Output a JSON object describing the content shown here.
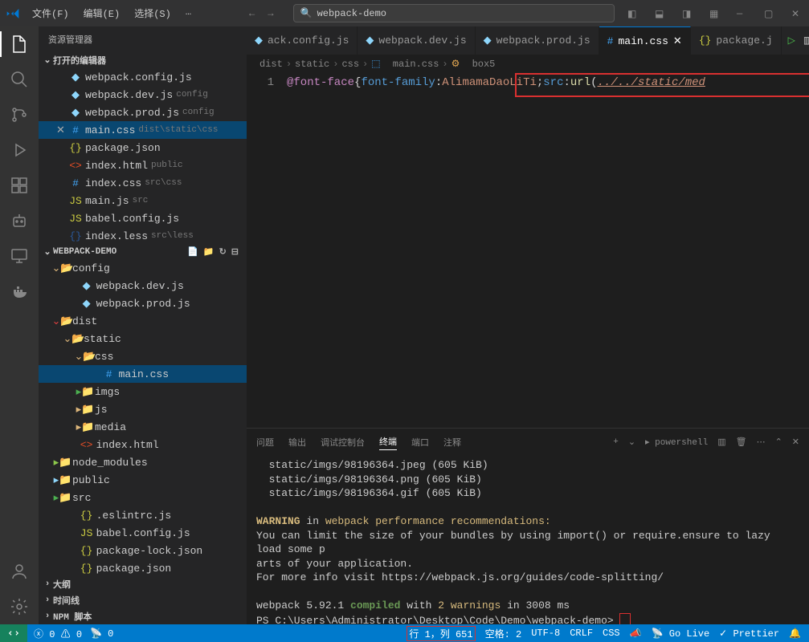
{
  "menu": {
    "file": "文件(F)",
    "edit": "编辑(E)",
    "select": "选择(S)",
    "more": "…"
  },
  "search_text": "webpack-demo",
  "sidebar_title": "资源管理器",
  "open_editors": {
    "title": "打开的编辑器",
    "items": [
      {
        "name": "webpack.config.js",
        "desc": ""
      },
      {
        "name": "webpack.dev.js",
        "desc": "config"
      },
      {
        "name": "webpack.prod.js",
        "desc": "config"
      },
      {
        "name": "main.css",
        "desc": "dist\\static\\css",
        "active": true
      },
      {
        "name": "package.json",
        "desc": ""
      },
      {
        "name": "index.html",
        "desc": "public"
      },
      {
        "name": "index.css",
        "desc": "src\\css"
      },
      {
        "name": "main.js",
        "desc": "src"
      },
      {
        "name": "babel.config.js",
        "desc": ""
      },
      {
        "name": "index.less",
        "desc": "src\\less"
      }
    ]
  },
  "project": {
    "name": "WEBPACK-DEMO",
    "tree": [
      {
        "l": 1,
        "t": "folder-open",
        "n": "config"
      },
      {
        "l": 2,
        "t": "webpack",
        "n": "webpack.dev.js"
      },
      {
        "l": 2,
        "t": "webpack",
        "n": "webpack.prod.js"
      },
      {
        "l": 1,
        "t": "folder-open",
        "n": "dist",
        "cls": "ico-red"
      },
      {
        "l": 2,
        "t": "folder-open",
        "n": "static"
      },
      {
        "l": 3,
        "t": "folder-open",
        "n": "css"
      },
      {
        "l": 4,
        "t": "css",
        "n": "main.css",
        "sel": true
      },
      {
        "l": 3,
        "t": "folder",
        "n": "imgs",
        "cls": "ico-src"
      },
      {
        "l": 3,
        "t": "folder",
        "n": "js"
      },
      {
        "l": 3,
        "t": "folder",
        "n": "media"
      },
      {
        "l": 2,
        "t": "html",
        "n": "index.html"
      },
      {
        "l": 1,
        "t": "folder",
        "n": "node_modules",
        "cls": "ico-node"
      },
      {
        "l": 1,
        "t": "folder",
        "n": "public",
        "cls": "ico-webpack"
      },
      {
        "l": 1,
        "t": "folder",
        "n": "src",
        "cls": "ico-src"
      },
      {
        "l": 2,
        "t": "json",
        "n": ".eslintrc.js"
      },
      {
        "l": 2,
        "t": "js",
        "n": "babel.config.js"
      },
      {
        "l": 2,
        "t": "json",
        "n": "package-lock.json"
      },
      {
        "l": 2,
        "t": "json",
        "n": "package.json"
      }
    ]
  },
  "outline": "大纲",
  "timeline": "时间线",
  "npm": "NPM 脚本",
  "tabs": [
    {
      "n": "ack.config.js",
      "ico": "webpack"
    },
    {
      "n": "webpack.dev.js",
      "ico": "webpack"
    },
    {
      "n": "webpack.prod.js",
      "ico": "webpack"
    },
    {
      "n": "main.css",
      "ico": "css",
      "active": true,
      "close": true
    },
    {
      "n": "package.j",
      "ico": "json"
    }
  ],
  "breadcrumb": [
    "dist",
    "static",
    "css",
    "main.css",
    "box5"
  ],
  "code": {
    "line_num": "1",
    "at": "@font-face",
    "brace": "{",
    "p1": "font-family",
    "v1": "AlimamaDaoLiTi",
    "p2": "src",
    "fn": "url",
    "paren": "(",
    "path": "../../static/med"
  },
  "term": {
    "tabs": {
      "problems": "问题",
      "output": "输出",
      "debug": "调试控制台",
      "terminal": "终端",
      "ports": "端口",
      "comments": "注释"
    },
    "shell": "powershell",
    "lines": [
      "static/imgs/98196364.jpeg (605 KiB)",
      "static/imgs/98196364.png (605 KiB)",
      "static/imgs/98196364.gif (605 KiB)"
    ],
    "warn_label": "WARNING",
    "warn_in": " in ",
    "warn_msg": "webpack performance recommendations:",
    "warn_body1": "You can limit the size of your bundles by using import() or require.ensure to lazy load some p",
    "warn_body2": "arts of your application.",
    "warn_body3": "For more info visit https://webpack.js.org/guides/code-splitting/",
    "compiled1": "webpack 5.92.1 ",
    "compiled_ok": "compiled",
    "compiled2": " with ",
    "compiled_warn": "2 warnings",
    "compiled3": " in 3008 ms",
    "prompt": "PS C:\\Users\\Administrator\\Desktop\\Code\\Demo\\webpack-demo> "
  },
  "status": {
    "errors": "0",
    "warnings": "0",
    "port": "0",
    "pos": "行 1，列 651",
    "spaces": "空格: 2",
    "enc": "UTF-8",
    "eol": "CRLF",
    "lang": "CSS",
    "golive": "Go Live",
    "prettier": "Prettier"
  }
}
